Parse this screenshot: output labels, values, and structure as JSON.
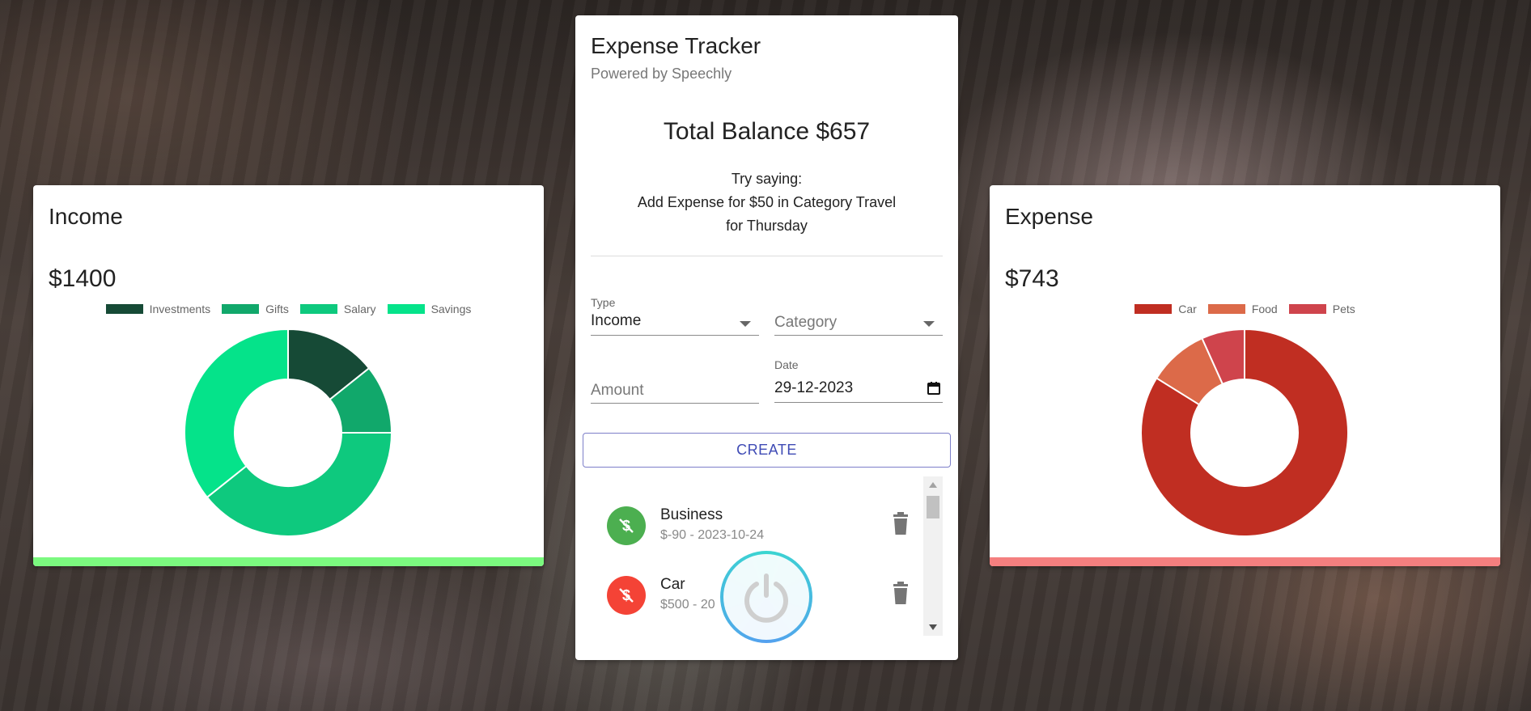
{
  "income_card": {
    "title": "Income",
    "amount": "$1400",
    "bar_color": "#7bf97f",
    "chart_data": {
      "type": "pie",
      "categories": [
        "Investments",
        "Gifts",
        "Salary",
        "Savings"
      ],
      "values": [
        200,
        150,
        550,
        500
      ],
      "colors": [
        "#164a36",
        "#11a86b",
        "#0ec97e",
        "#05e38a"
      ],
      "legend": "top"
    }
  },
  "expense_card": {
    "title": "Expense",
    "amount": "$743",
    "bar_color": "#f47f7f",
    "chart_data": {
      "type": "pie",
      "categories": [
        "Car",
        "Food",
        "Pets"
      ],
      "values": [
        623,
        70,
        50
      ],
      "colors": [
        "#c02e22",
        "#dc6a49",
        "#cf444c"
      ],
      "legend": "top"
    }
  },
  "main_card": {
    "title": "Expense Tracker",
    "subtitle": "Powered by Speechly",
    "balance": "Total Balance $657",
    "hint_line1": "Try saying:",
    "hint_line2": "Add Expense for $50 in Category Travel",
    "hint_line3": "for Thursday",
    "form": {
      "type_label": "Type",
      "type_value": "Income",
      "category_placeholder": "Category",
      "amount_placeholder": "Amount",
      "date_label": "Date",
      "date_value": "29-12-2023",
      "create_label": "CREATE"
    },
    "transactions": [
      {
        "title": "Business",
        "subtitle": "$-90 - 2023-10-24",
        "color": "#4caf50"
      },
      {
        "title": "Car",
        "subtitle": "$500 - 20",
        "color": "#f44336"
      }
    ]
  }
}
